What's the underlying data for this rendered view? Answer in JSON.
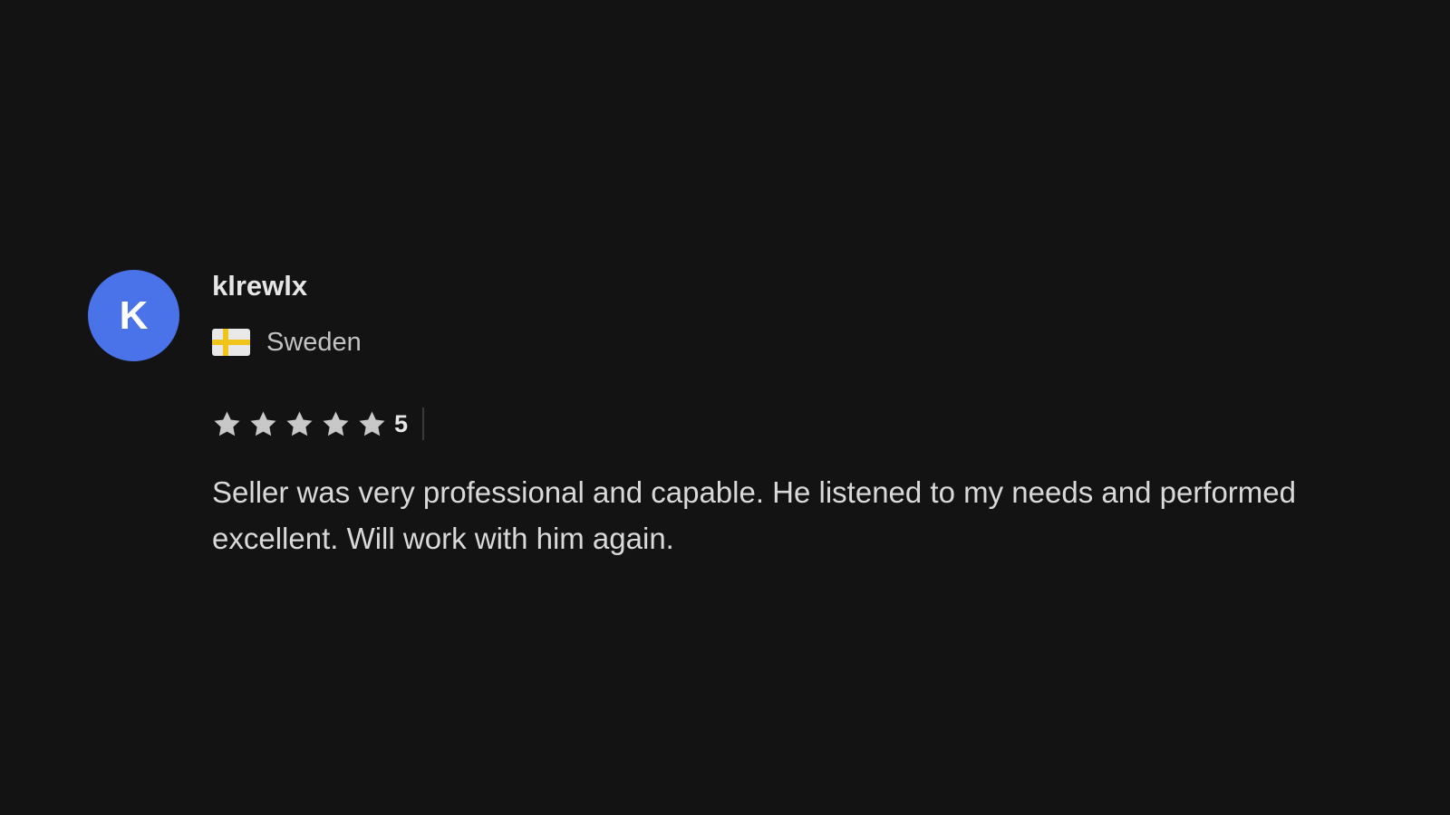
{
  "review": {
    "avatar_initial": "K",
    "avatar_color": "#4a73ea",
    "username": "klrewlx",
    "country": "Sweden",
    "flag_icon": "sweden-flag",
    "rating": 5,
    "rating_label": "5",
    "rating_max": 5,
    "text": "Seller was very professional and capable. He listened to my needs and performed excellent. Will work with him again."
  },
  "colors": {
    "background": "#131313",
    "star": "#c8c8c8"
  }
}
